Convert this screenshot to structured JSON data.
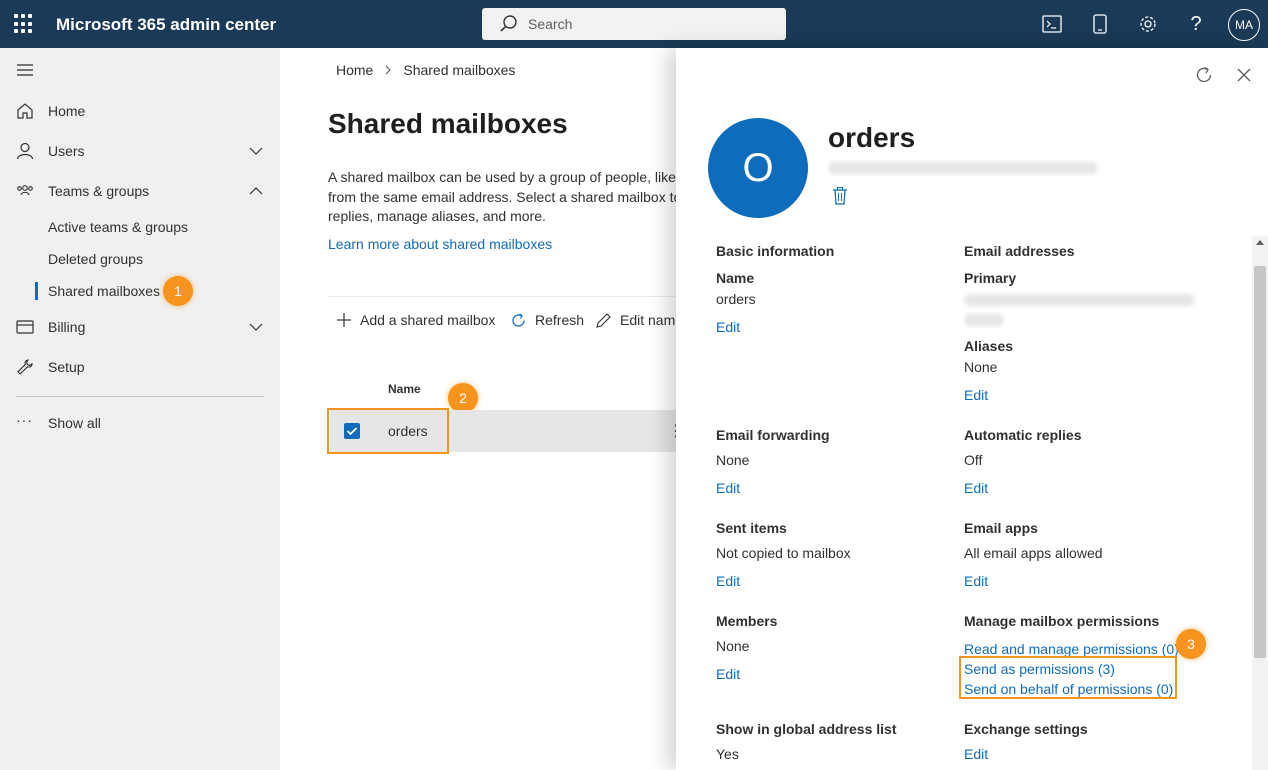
{
  "app": {
    "title": "Microsoft 365 admin center",
    "user_initials": "MA"
  },
  "search": {
    "placeholder": "Search"
  },
  "sidebar": {
    "home": "Home",
    "users": "Users",
    "teams_groups": "Teams & groups",
    "sub_items": [
      "Active teams & groups",
      "Deleted groups",
      "Shared mailboxes"
    ],
    "billing": "Billing",
    "setup": "Setup",
    "show_all": "Show all"
  },
  "badges": [
    "1",
    "2",
    "3"
  ],
  "main": {
    "breadcrumb": [
      "Home",
      "Shared mailboxes"
    ],
    "title": "Shared mailboxes",
    "description": "A shared mailbox can be used by a group of people, like\nfrom the same email address. Select a shared mailbox to\nreplies, manage aliases, and more.",
    "learn_more": "Learn more about shared mailboxes",
    "commands": {
      "add": "Add a shared mailbox",
      "refresh": "Refresh",
      "edit": "Edit name"
    },
    "column_name": "Name",
    "rows": [
      {
        "name": "orders"
      }
    ]
  },
  "panel": {
    "initial": "O",
    "name": "orders",
    "basic_info": {
      "heading": "Basic information",
      "label": "Name",
      "value": "orders",
      "edit": "Edit"
    },
    "email_addresses": {
      "heading": "Email addresses",
      "primary_label": "Primary",
      "aliases_label": "Aliases",
      "aliases_value": "None",
      "edit": "Edit"
    },
    "email_forwarding": {
      "heading": "Email forwarding",
      "value": "None",
      "edit": "Edit"
    },
    "automatic_replies": {
      "heading": "Automatic replies",
      "value": "Off",
      "edit": "Edit"
    },
    "sent_items": {
      "heading": "Sent items",
      "value": "Not copied to mailbox",
      "edit": "Edit"
    },
    "email_apps": {
      "heading": "Email apps",
      "value": "All email apps allowed",
      "edit": "Edit"
    },
    "members": {
      "heading": "Members",
      "value": "None",
      "edit": "Edit"
    },
    "permissions": {
      "heading": "Manage mailbox permissions",
      "read_manage": "Read and manage permissions (0)",
      "send_as": "Send as permissions (3)",
      "send_on_behalf": "Send on behalf of permissions (0)"
    },
    "gal": {
      "heading": "Show in global address list",
      "value": "Yes"
    },
    "exchange": {
      "heading": "Exchange settings",
      "edit": "Edit"
    }
  },
  "colors": {
    "topbar": "#1b3a57",
    "accent": "#0f6cbd",
    "callout": "#f7941d",
    "sidebar": "#f0f0f0"
  }
}
